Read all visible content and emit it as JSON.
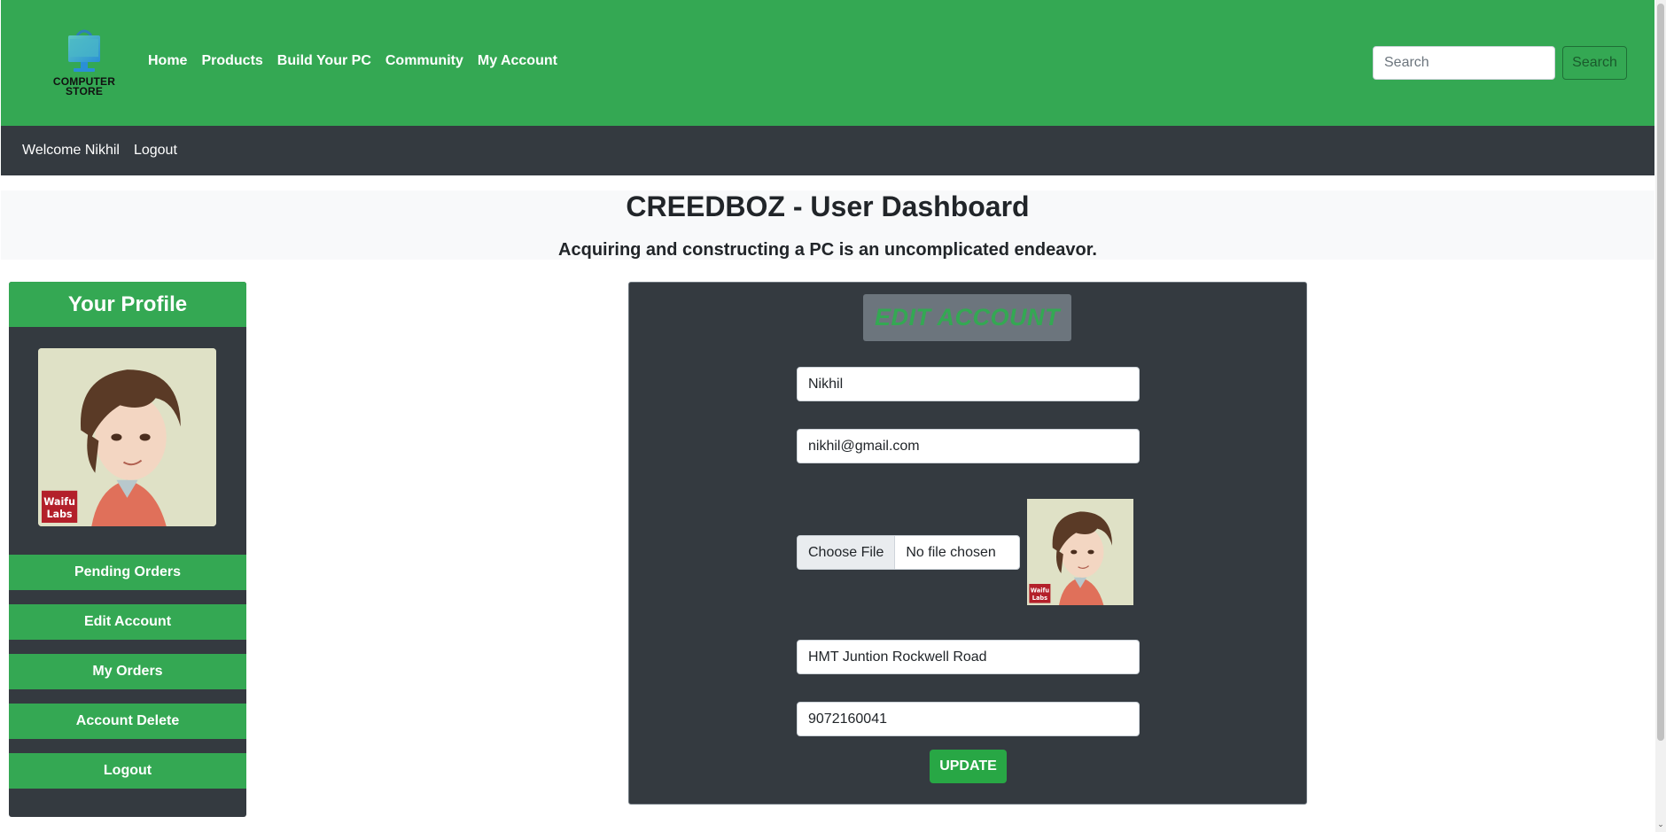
{
  "brand": {
    "logo_text": "COMPUTER STORE",
    "logo_icon": "shopping-bag-monitor-icon"
  },
  "nav": {
    "items": [
      "Home",
      "Products",
      "Build Your PC",
      "Community",
      "My Account"
    ],
    "search_placeholder": "Search",
    "search_button": "Search"
  },
  "userbar": {
    "welcome": "Welcome Nikhil",
    "logout": "Logout"
  },
  "hero": {
    "title": "CREEDBOZ - User Dashboard",
    "subtitle": "Acquiring and constructing a PC is an uncomplicated endeavor."
  },
  "profile": {
    "heading": "Your Profile",
    "avatar_watermark": "Waifu Labs",
    "menu": [
      "Pending Orders",
      "Edit Account",
      "My Orders",
      "Account Delete",
      "Logout"
    ]
  },
  "edit_account": {
    "title": "EDIT ACCOUNT",
    "name_value": "Nikhil",
    "email_value": "nikhil@gmail.com",
    "file_button": "Choose File",
    "file_status": "No file chosen",
    "address_value": "HMT Juntion Rockwell Road",
    "phone_value": "9072160041",
    "update_button": "UPDATE"
  },
  "colors": {
    "primary_green": "#34a853",
    "dark": "#343a40",
    "muted": "#6c757d",
    "button_green": "#28a745"
  }
}
